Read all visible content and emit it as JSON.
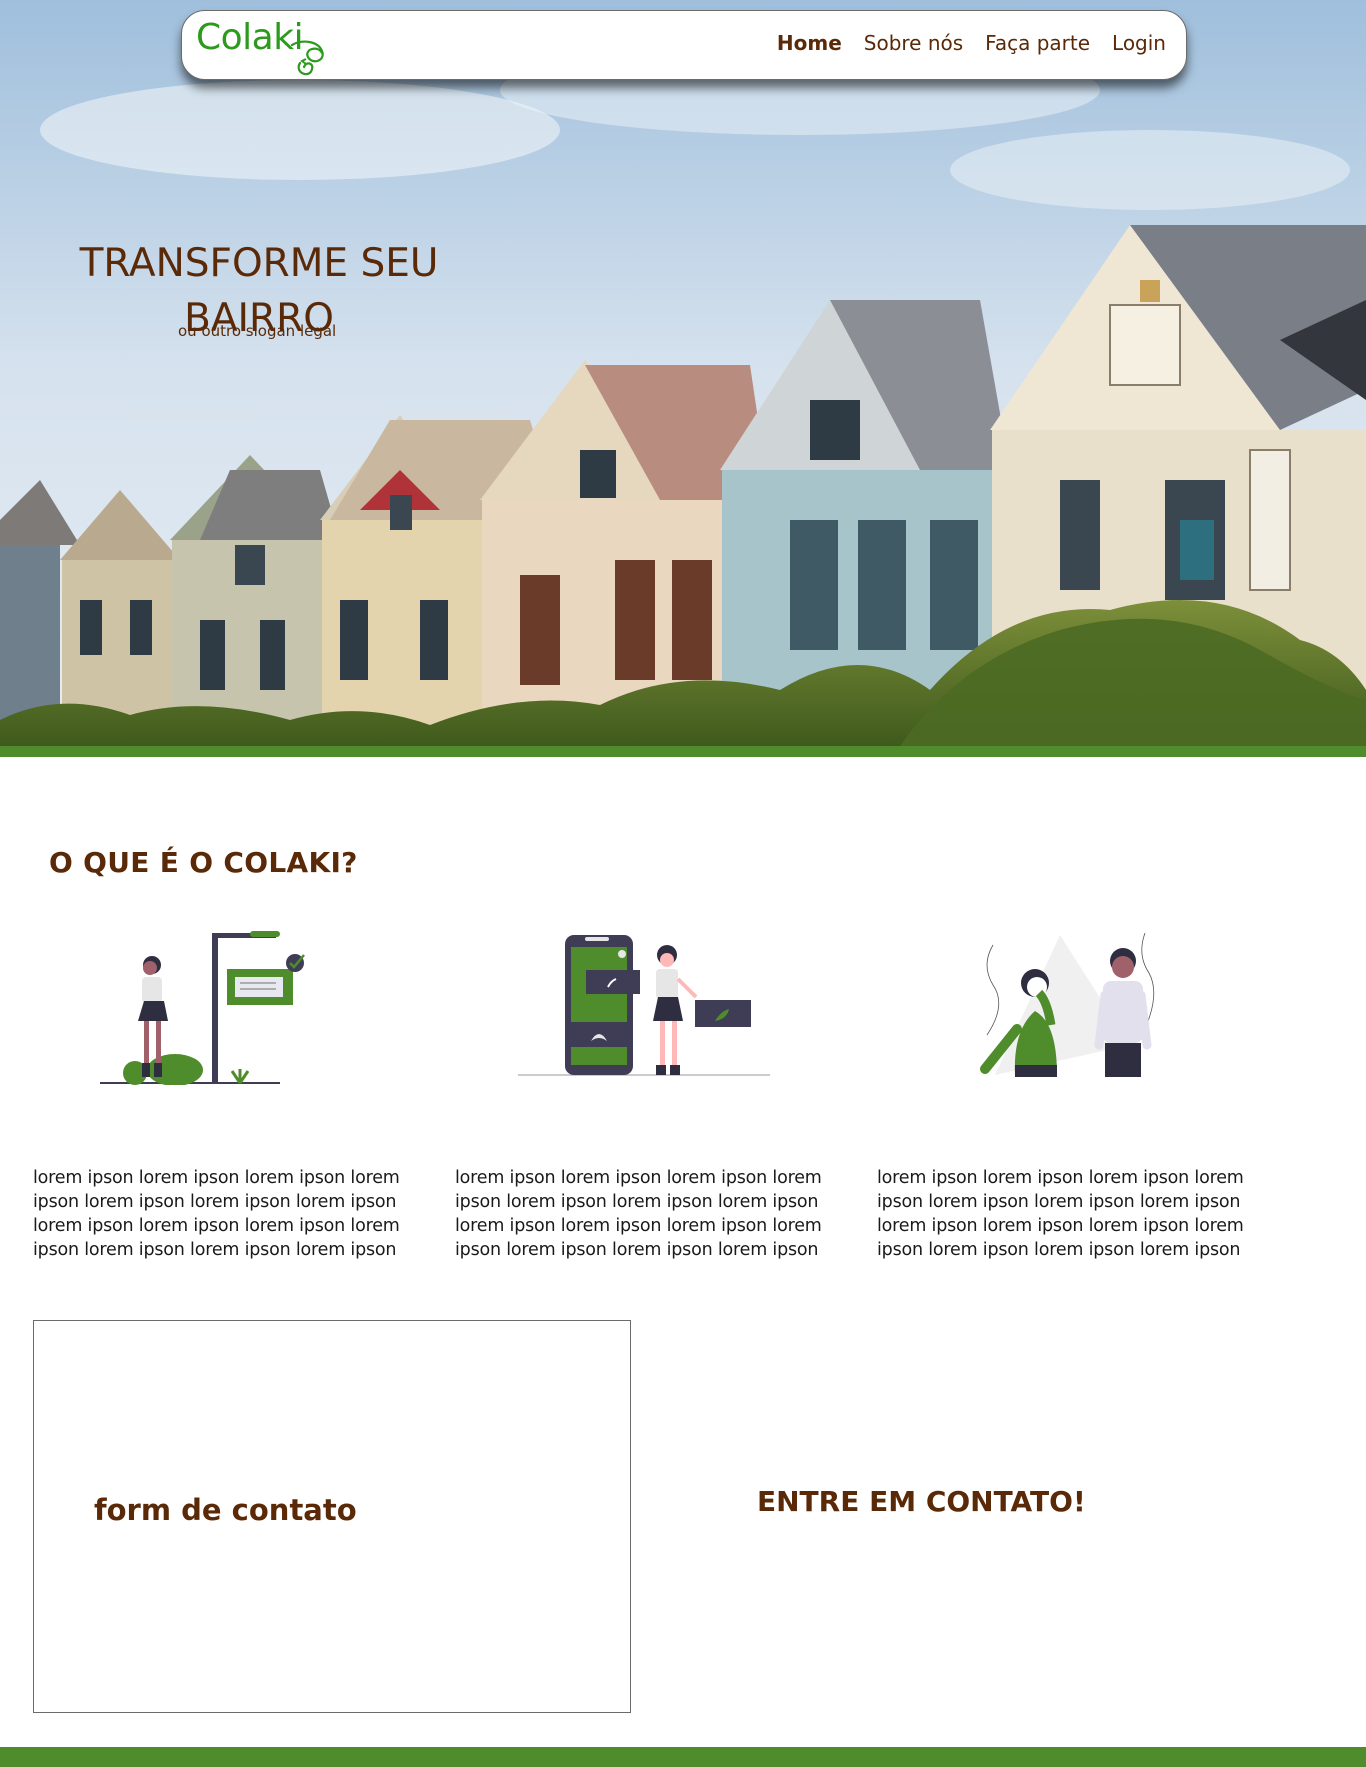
{
  "brand": {
    "name": "Colaki",
    "primary_green": "#4f8c2c",
    "text_brown": "#5a2a08",
    "logo_green": "#2c9a1c"
  },
  "nav": {
    "links": [
      {
        "label": "Home",
        "active": true
      },
      {
        "label": "Sobre nós",
        "active": false
      },
      {
        "label": "Faça parte",
        "active": false
      },
      {
        "label": "Login",
        "active": false
      }
    ]
  },
  "hero": {
    "title": "TRANSFORME SEU BAIRRO",
    "slogan": "ou outro slogan legal",
    "image": "victorian-houses-row"
  },
  "about": {
    "title": "O QUE É O COLAKI?",
    "features": [
      {
        "illustration": "woman-at-signpost-illustration",
        "text": "lorem ipson lorem ipson lorem ipson lorem ipson lorem ipson lorem ipson lorem ipson lorem ipson lorem ipson lorem ipson lorem ipson lorem ipson lorem ipson lorem ipson"
      },
      {
        "illustration": "woman-with-phone-app-illustration",
        "text": "lorem ipson lorem ipson lorem ipson lorem ipson lorem ipson lorem ipson lorem ipson lorem ipson lorem ipson lorem ipson lorem ipson lorem ipson lorem ipson lorem ipson"
      },
      {
        "illustration": "two-people-waving-illustration",
        "text": "lorem ipson lorem ipson lorem ipson lorem ipson lorem ipson lorem ipson lorem ipson lorem ipson lorem ipson lorem ipson lorem ipson lorem ipson lorem ipson lorem ipson"
      }
    ]
  },
  "contact": {
    "form_label": "form de contato",
    "cta": "ENTRE EM CONTATO!"
  }
}
